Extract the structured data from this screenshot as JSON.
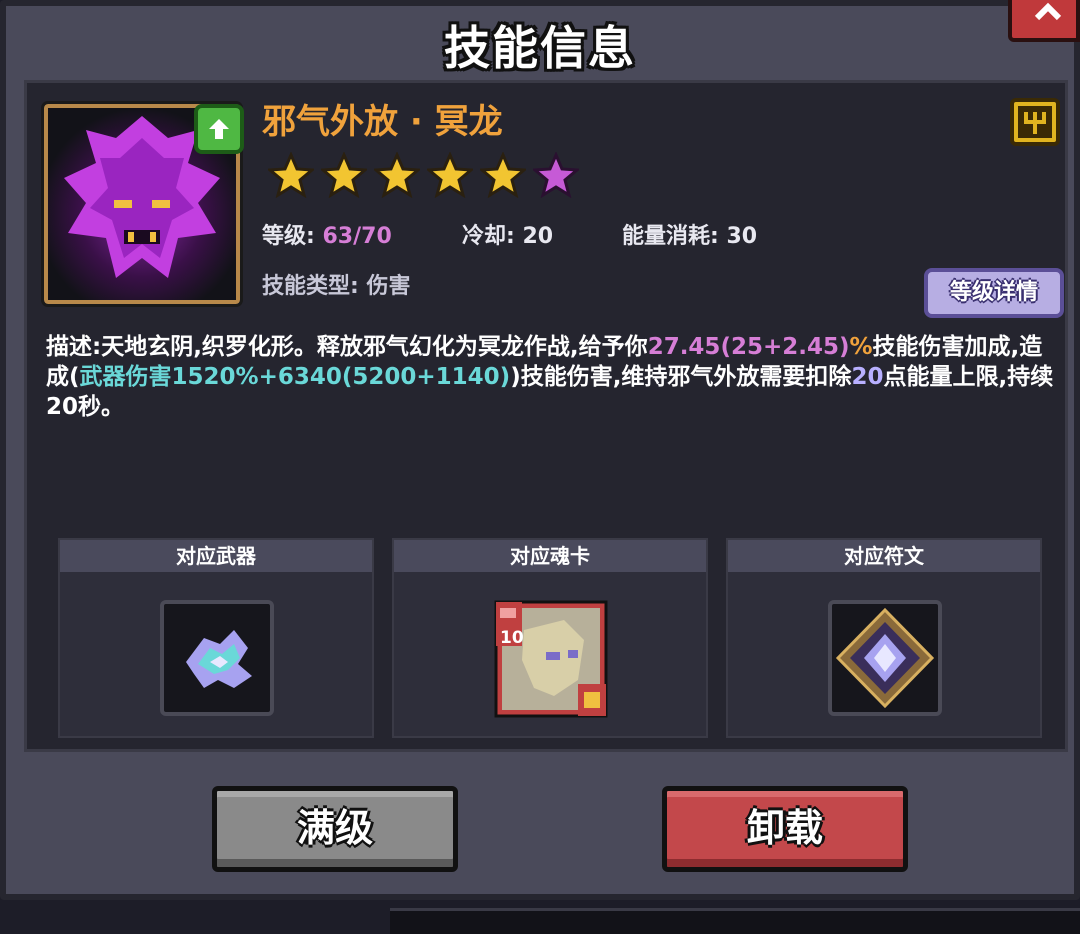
{
  "dialog": {
    "title": "技能信息"
  },
  "skill": {
    "name": "邪气外放 · 冥龙",
    "stars_gold": 5,
    "stars_purple": 1,
    "level_label": "等级:",
    "level_value": "63/70",
    "cooldown_label": "冷却:",
    "cooldown_value": "20",
    "energy_label": "能量消耗:",
    "energy_value": "30",
    "type_label": "技能类型:",
    "type_value": "伤害",
    "detail_button": "等级详情"
  },
  "description": {
    "p1": "描述:天地玄阴,织罗化形。释放邪气幻化为冥龙作战,给予你",
    "p2": "27.45(25+2.45)",
    "p3": "%",
    "p4": "技能伤害加成,造成(",
    "p5": "武器伤害1520%+6340(5200+1140)",
    "p6": ")技能伤害,维持邪气外放需要扣除",
    "p7": "20",
    "p8": "点能量上限,持续20秒。"
  },
  "slots": {
    "weapon": "对应武器",
    "soul_card": "对应魂卡",
    "rune": "对应符文",
    "soul_card_level": "10"
  },
  "buttons": {
    "max_level": "满级",
    "unload": "卸载"
  },
  "colors": {
    "accent_orange": "#f0a23c",
    "accent_purple": "#d67ed6",
    "accent_cyan": "#6ad8d8",
    "unload_red": "#c3484b"
  },
  "icons": [
    "close-icon",
    "upgrade-arrow-icon",
    "rank-trident-icon",
    "star-icon",
    "weapon-icon",
    "soul-card-icon",
    "rune-icon"
  ]
}
